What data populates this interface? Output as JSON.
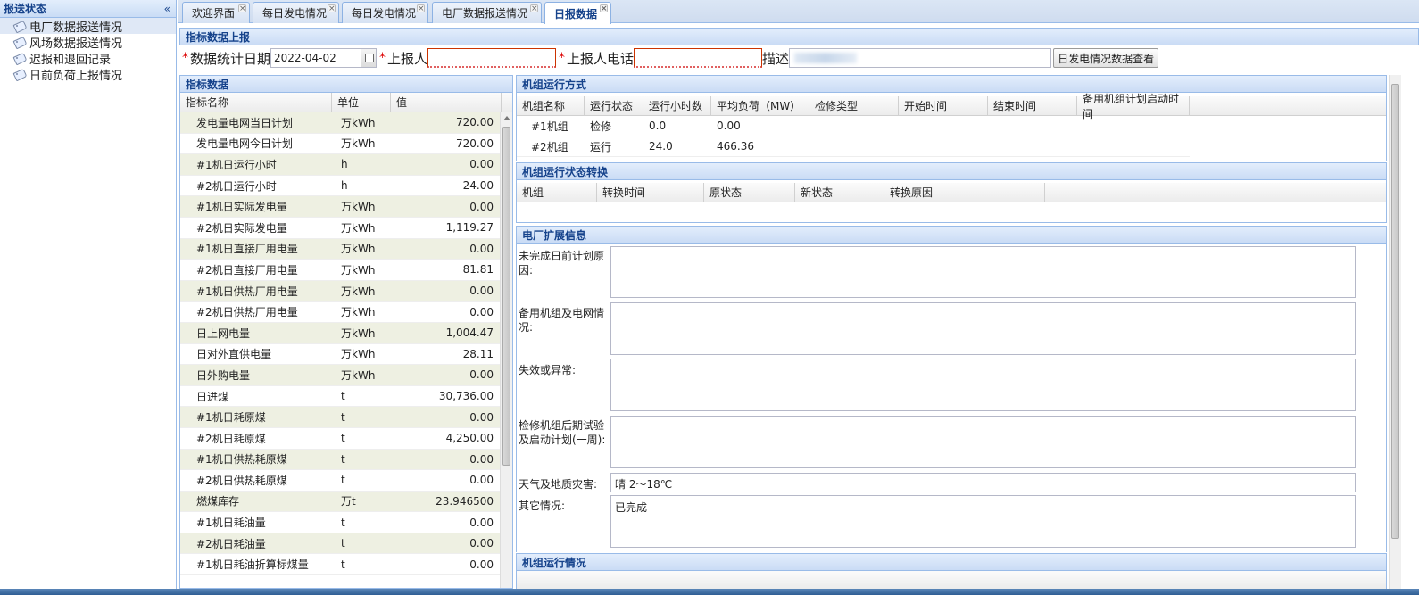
{
  "sidebar": {
    "title": "报送状态",
    "collapse": "«",
    "items": [
      {
        "label": "电厂数据报送情况",
        "selected": true
      },
      {
        "label": "风场数据报送情况",
        "selected": false
      },
      {
        "label": "迟报和退回记录",
        "selected": false
      },
      {
        "label": "日前负荷上报情况",
        "selected": false
      }
    ]
  },
  "tabs": [
    {
      "label": "欢迎界面",
      "active": false
    },
    {
      "label": "每日发电情况",
      "active": false
    },
    {
      "label": "每日发电情况",
      "active": false
    },
    {
      "label": "电厂数据报送情况",
      "active": false
    },
    {
      "label": "日报数据",
      "active": true
    }
  ],
  "tab_close": "×",
  "report": {
    "title": "指标数据上报",
    "required_mark": "*",
    "date_label": "数据统计日期",
    "date_value": "2022-04-02",
    "reporter_label": "上报人",
    "reporter_value": "",
    "phone_label": "上报人电话",
    "phone_value": "",
    "desc_label": "描述",
    "desc_value": "",
    "view_button": "日发电情况数据查看"
  },
  "indicators": {
    "title": "指标数据",
    "columns": [
      "指标名称",
      "单位",
      "值"
    ],
    "rows": [
      {
        "name": "发电量电网当日计划",
        "unit": "万kWh",
        "value": "720.00"
      },
      {
        "name": "发电量电网今日计划",
        "unit": "万kWh",
        "value": "720.00"
      },
      {
        "name": "#1机日运行小时",
        "unit": "h",
        "value": "0.00"
      },
      {
        "name": "#2机日运行小时",
        "unit": "h",
        "value": "24.00"
      },
      {
        "name": "#1机日实际发电量",
        "unit": "万kWh",
        "value": "0.00"
      },
      {
        "name": "#2机日实际发电量",
        "unit": "万kWh",
        "value": "1,119.27"
      },
      {
        "name": "#1机日直接厂用电量",
        "unit": "万kWh",
        "value": "0.00"
      },
      {
        "name": "#2机日直接厂用电量",
        "unit": "万kWh",
        "value": "81.81"
      },
      {
        "name": "#1机日供热厂用电量",
        "unit": "万kWh",
        "value": "0.00"
      },
      {
        "name": "#2机日供热厂用电量",
        "unit": "万kWh",
        "value": "0.00"
      },
      {
        "name": "日上网电量",
        "unit": "万kWh",
        "value": "1,004.47"
      },
      {
        "name": "日对外直供电量",
        "unit": "万kWh",
        "value": "28.11"
      },
      {
        "name": "日外购电量",
        "unit": "万kWh",
        "value": "0.00"
      },
      {
        "name": "日进煤",
        "unit": "t",
        "value": "30,736.00"
      },
      {
        "name": "#1机日耗原煤",
        "unit": "t",
        "value": "0.00"
      },
      {
        "name": "#2机日耗原煤",
        "unit": "t",
        "value": "4,250.00"
      },
      {
        "name": "#1机日供热耗原煤",
        "unit": "t",
        "value": "0.00"
      },
      {
        "name": "#2机日供热耗原煤",
        "unit": "t",
        "value": "0.00"
      },
      {
        "name": "燃煤库存",
        "unit": "万t",
        "value": "23.946500"
      },
      {
        "name": "#1机日耗油量",
        "unit": "t",
        "value": "0.00"
      },
      {
        "name": "#2机日耗油量",
        "unit": "t",
        "value": "0.00"
      },
      {
        "name": "#1机日耗油折算标煤量",
        "unit": "t",
        "value": "0.00"
      }
    ]
  },
  "unit_mode": {
    "title": "机组运行方式",
    "columns": [
      "机组名称",
      "运行状态",
      "运行小时数",
      "平均负荷（MW）",
      "检修类型",
      "开始时间",
      "结束时间",
      "备用机组计划启动时间"
    ],
    "rows": [
      [
        "#1机组",
        "检修",
        "0.0",
        "0.00",
        "",
        "",
        "",
        ""
      ],
      [
        "#2机组",
        "运行",
        "24.0",
        "466.36",
        "",
        "",
        "",
        ""
      ]
    ]
  },
  "unit_transition": {
    "title": "机组运行状态转换",
    "columns": [
      "机组",
      "转换时间",
      "原状态",
      "新状态",
      "转换原因"
    ]
  },
  "extension": {
    "title": "电厂扩展信息",
    "fields": [
      {
        "label": "未完成日前计划原因:",
        "value": ""
      },
      {
        "label": "备用机组及电网情况:",
        "value": ""
      },
      {
        "label": "失效或异常:",
        "value": ""
      },
      {
        "label": "检修机组后期试验及启动计划(一周):",
        "value": ""
      },
      {
        "label": "天气及地质灾害:",
        "value": "晴 2～18℃"
      },
      {
        "label": "其它情况:",
        "value": "已完成"
      }
    ]
  },
  "unit_status": {
    "title": "机组运行情况"
  }
}
